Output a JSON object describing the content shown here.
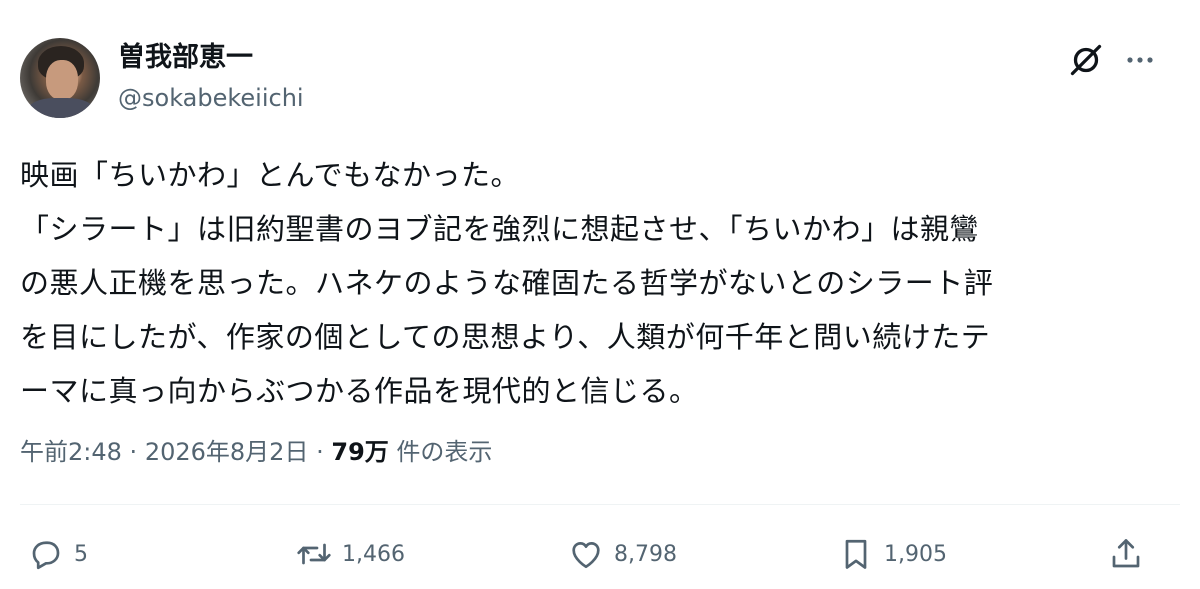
{
  "author": {
    "display_name": "曽我部恵一",
    "handle": "@sokabekeiichi"
  },
  "tweet": {
    "lines": [
      "映画「ちいかわ」とんでもなかった。",
      "「シラート」は旧約聖書のヨブ記を強烈に想起させ、「ちいかわ」は親鸞",
      "の悪人正機を思った。ハネケのような確固たる哲学がないとのシラート評",
      "を目にしたが、作家の個としての思想より、人類が何千年と問い続けたテ",
      "ーマに真っ向からぶつかる作品を現代的と信じる。"
    ]
  },
  "meta": {
    "time": "午前2:48",
    "separator": "·",
    "date": "2026年8月2日",
    "views_count": "79万",
    "views_label": "件の表示"
  },
  "actions": {
    "replies": "5",
    "reposts": "1,466",
    "likes": "8,798",
    "bookmarks": "1,905"
  },
  "icons": [
    "grok-icon",
    "more-icon",
    "reply-icon",
    "repost-icon",
    "like-icon",
    "bookmark-icon",
    "share-icon"
  ],
  "colors": {
    "text": "#0f1419",
    "secondary": "#536471",
    "divider": "#eff3f4"
  }
}
